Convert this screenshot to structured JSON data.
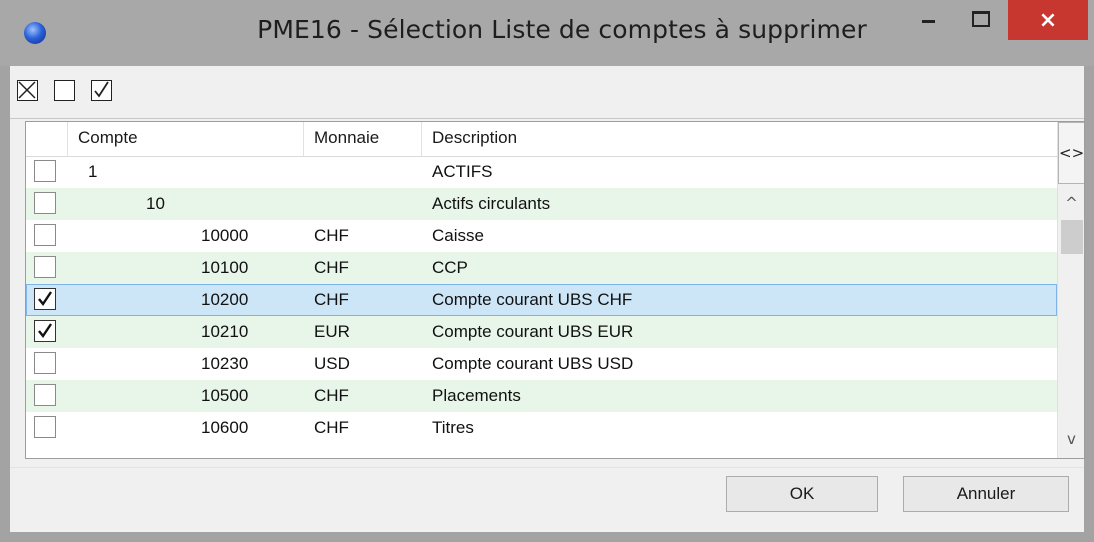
{
  "window": {
    "title": "PME16 - Sélection Liste de comptes à supprimer",
    "close_glyph": "×"
  },
  "toolbar": {
    "tools": [
      {
        "name": "toggle-all-icon"
      },
      {
        "name": "uncheck-all-icon"
      },
      {
        "name": "check-all-icon"
      }
    ]
  },
  "grid": {
    "columns": [
      "Compte",
      "Monnaie",
      "Description"
    ],
    "expand_label": "<>",
    "scroll_up": "^",
    "scroll_down": "v",
    "rows": [
      {
        "checked": false,
        "compte": "1",
        "level": 0,
        "monnaie": "",
        "description": "ACTIFS"
      },
      {
        "checked": false,
        "compte": "10",
        "level": 1,
        "monnaie": "",
        "description": "Actifs circulants"
      },
      {
        "checked": false,
        "compte": "10000",
        "level": 2,
        "monnaie": "CHF",
        "description": "Caisse"
      },
      {
        "checked": false,
        "compte": "10100",
        "level": 2,
        "monnaie": "CHF",
        "description": "CCP"
      },
      {
        "checked": true,
        "compte": "10200",
        "level": 2,
        "monnaie": "CHF",
        "description": "Compte courant UBS CHF",
        "selected": true
      },
      {
        "checked": true,
        "compte": "10210",
        "level": 2,
        "monnaie": "EUR",
        "description": "Compte courant UBS EUR"
      },
      {
        "checked": false,
        "compte": "10230",
        "level": 2,
        "monnaie": "USD",
        "description": "Compte courant UBS USD"
      },
      {
        "checked": false,
        "compte": "10500",
        "level": 2,
        "monnaie": "CHF",
        "description": "Placements"
      },
      {
        "checked": false,
        "compte": "10600",
        "level": 2,
        "monnaie": "CHF",
        "description": "Titres"
      }
    ]
  },
  "buttons": {
    "ok": "OK",
    "cancel": "Annuler"
  },
  "colors": {
    "alt_row": "#e8f5e9",
    "selected_row": "#cde6f7",
    "close_button": "#c7372f"
  }
}
